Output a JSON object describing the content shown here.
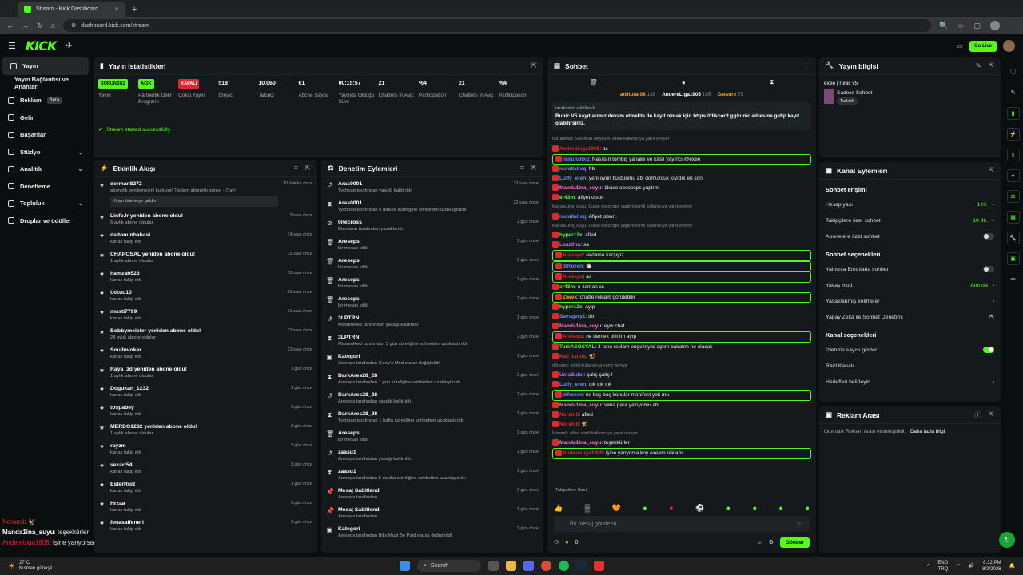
{
  "browser": {
    "tab_title": "Stream - Kick Dashboard",
    "url": "dashboard.kick.com/stream"
  },
  "nav": {
    "logo": "KICK",
    "golive": "Go Live"
  },
  "sidebar": {
    "items": [
      {
        "label": "Yayın"
      },
      {
        "label": "Yayın Bağlantısı ve Anahtarı"
      },
      {
        "label": "Reklam",
        "badge": "Beta"
      },
      {
        "label": "Gelir"
      },
      {
        "label": "Başarılar"
      },
      {
        "label": "Stüdyo"
      },
      {
        "label": "Analitik"
      },
      {
        "label": "Denetleme"
      },
      {
        "label": "Topluluk"
      },
      {
        "label": "Droplar ve ödüller"
      }
    ]
  },
  "overlay": [
    {
      "u": "Noramli",
      "m": ": 🦅"
    },
    {
      "u": "Manda1ina_suyu",
      "m": ": teşekkürler"
    },
    {
      "u": "AndereLiga1905",
      "m": ": işine yanyorsa koy exeem reklamı"
    }
  ],
  "stats": {
    "title": "Yayın İstatistikleri",
    "started": "Stream started successfully.",
    "items": [
      {
        "v": "SORUNSUZ",
        "l": "Yayın",
        "k": "g"
      },
      {
        "v": "AÇIK",
        "l": "Partnerlik Gelir Programı",
        "k": "g"
      },
      {
        "v": "KAPALI",
        "l": "Çoklu Yayın",
        "k": "r"
      },
      {
        "v": "518",
        "l": "İzleyici"
      },
      {
        "v": "10.060",
        "l": "Takipçi"
      },
      {
        "v": "61",
        "l": "Abone Sayısı"
      },
      {
        "v": "00:15:57",
        "l": "Yayında Olduğu Süre"
      },
      {
        "v": "21",
        "l": "Chatters In Avg."
      },
      {
        "v": "%4",
        "l": "Participation"
      },
      {
        "v": "21",
        "l": "Chatters In Avg."
      },
      {
        "v": "%4",
        "l": "Participation"
      }
    ]
  },
  "activity": {
    "title": "Etkinlik Akışı",
    "items": [
      {
        "i": "★",
        "t1": "derman8272",
        "t2": "abonelik yenilemesini kutluyor! Toplam abonelik süresi - 7 ay!",
        "tm": "10 dakika önce",
        "x": "Kirayı ödemeye geldim"
      },
      {
        "i": "★",
        "t1": "LinfoJr yeniden abone oldu!",
        "t2": "6 aylık abone oldular",
        "tm": "3 saat önce"
      },
      {
        "i": "♥",
        "t1": "daltonunbabasi",
        "t2": "kanalı takip etti",
        "tm": "14 saat önce"
      },
      {
        "i": "★",
        "t1": "CHAPOSAL yeniden abone oldu!",
        "t2": "1 aylık abone oldular",
        "tm": "15 saat önce"
      },
      {
        "i": "♥",
        "t1": "hamzab523",
        "t2": "kanalı takip etti",
        "tm": "18 saat önce"
      },
      {
        "i": "♥",
        "t1": "Utkuu10",
        "t2": "kanalı takip etti",
        "tm": "20 saat önce"
      },
      {
        "i": "♥",
        "t1": "musti7799",
        "t2": "kanalı takip etti",
        "tm": "21 saat önce"
      },
      {
        "i": "★",
        "t1": "Bobbymeister yeniden abone oldu!",
        "t2": "24 aylık abone oldular",
        "tm": "22 saat önce"
      },
      {
        "i": "♥",
        "t1": "Soullnvoker",
        "t2": "kanalı takip etti",
        "tm": "23 saat önce"
      },
      {
        "i": "★",
        "t1": "Raya_3d yeniden abone oldu!",
        "t2": "1 aylık abone oldular",
        "tm": "1 gün önce"
      },
      {
        "i": "♥",
        "t1": "Dogukan_1232",
        "t2": "kanalı takip etti",
        "tm": "1 gün önce"
      },
      {
        "i": "♥",
        "t1": "tospabey",
        "t2": "kanalı takip etti",
        "tm": "1 gün önce"
      },
      {
        "i": "★",
        "t1": "MERDO1282 yeniden abone oldu!",
        "t2": "1 aylık abone oldular",
        "tm": "1 gün önce"
      },
      {
        "i": "♥",
        "t1": "rayzm",
        "t2": "kanalı takip etti",
        "tm": "1 gün önce"
      },
      {
        "i": "♥",
        "t1": "sezarr54",
        "t2": "kanalı takip etti",
        "tm": "1 gün önce"
      },
      {
        "i": "♥",
        "t1": "EsterRuiz",
        "t2": "kanalı takip etti",
        "tm": "1 gün önce"
      },
      {
        "i": "♥",
        "t1": "Hrzaa",
        "t2": "kanalı takip etti",
        "tm": "1 gün önce"
      },
      {
        "i": "♥",
        "t1": "fenasalfeneri",
        "t2": "kanalı takip etti",
        "tm": "1 gün önce"
      }
    ]
  },
  "mod": {
    "title": "Denetim Eylemleri",
    "items": [
      {
        "i": "↺",
        "t1": "Aras0001",
        "t2": "Tychooo tarafından yasağı kaldırıldı",
        "tm": "22 saat önce"
      },
      {
        "i": "⧗",
        "t1": "Aras0001",
        "t2": "Tychooo tarafından 5 dakika süreliğine sohbetten uzaklaştırıldı",
        "tm": "22 saat önce"
      },
      {
        "i": "⊘",
        "t1": "0necross",
        "t2": "Ebonivon tarafından yasaklandı",
        "tm": "1 gün önce"
      },
      {
        "i": "🗑",
        "t1": "Areseps",
        "t2": "bir mesajı sildi",
        "tm": "1 gün önce"
      },
      {
        "i": "🗑",
        "t1": "Areseps",
        "t2": "bir mesajı sildi",
        "tm": "1 gün önce"
      },
      {
        "i": "🗑",
        "t1": "Areseps",
        "t2": "bir mesajı sildi",
        "tm": "1 gün önce"
      },
      {
        "i": "🗑",
        "t1": "Areseps",
        "t2": "bir mesajı sildi",
        "tm": "1 gün önce"
      },
      {
        "i": "↺",
        "t1": "3LPTRN",
        "t2": "MasumKeci tarafından yasağı kaldırıldı",
        "tm": "1 gün önce"
      },
      {
        "i": "⧗",
        "t1": "3LPTRN",
        "t2": "MasumKeci tarafından 5 gün süreliğine sohbetten uzaklaştırıldı",
        "tm": "1 gün önce"
      },
      {
        "i": "▣",
        "t1": "Kategori",
        "t2": "Areseps tarafından Garry's Mod olarak değiştirildi",
        "tm": "1 gün önce"
      },
      {
        "i": "⧗",
        "t1": "DarkAres28_28",
        "t2": "Areseps tarafından 1 gün süreliğine sohbetten uzaklaştırıldı",
        "tm": "1 gün önce"
      },
      {
        "i": "↺",
        "t1": "DarkAres28_28",
        "t2": "Areseps tarafından yasağı kaldırıldı",
        "tm": "1 gün önce"
      },
      {
        "i": "⧗",
        "t1": "DarkAres28_28",
        "t2": "Tychooo tarafından 1 hafta süreliğine sohbetten uzaklaştırıldı",
        "tm": "1 gün önce"
      },
      {
        "i": "🗑",
        "t1": "Areseps",
        "t2": "bir mesajı sildi",
        "tm": "1 gün önce"
      },
      {
        "i": "↺",
        "t1": "zaasu1",
        "t2": "Areseps tarafından yasağı kaldırıldı",
        "tm": "1 gün önce"
      },
      {
        "i": "⧗",
        "t1": "zaasu1",
        "t2": "Areseps tarafından 5 dakika süreliğine sohbetten uzaklaştırıldı",
        "tm": "1 gün önce"
      },
      {
        "i": "📌",
        "t1": "Mesaj Sabitlendi",
        "t2": "Areseps tarafından",
        "tm": "1 gün önce"
      },
      {
        "i": "📌",
        "t1": "Mesaj Sabitlendi",
        "t2": "Areseps tarafından",
        "tm": "1 gün önce"
      },
      {
        "i": "▣",
        "t1": "Kategori",
        "t2": "Areseps tarafından Bills Must Be Paid olarak değiştirildi",
        "tm": "1 gün önce"
      }
    ]
  },
  "chat": {
    "title": "Sohbet",
    "top": [
      {
        "n": "aniltutar96",
        "v": "138",
        "c": "#f5a623"
      },
      {
        "n": "AndereLiga1905",
        "v": "105",
        "c": "#fff"
      },
      {
        "n": "Gatsure",
        "v": "75",
        "c": "#f5a623"
      }
    ],
    "pinned_by": "tarafından sabitlendi",
    "pinned": "Runic V5 kayıtlarımız devam etmekte de kayıt olmak için https://discord.gg/runic adresine gidip kayıt olabilirsiniz.",
    "messages": [
      {
        "s": "nurullahxq: Selamün aleyküm. isimli kullanıcıya yanıt veriyor"
      },
      {
        "u": "AndereLiga1905",
        "c": "#e5262d",
        "m": ": as"
      },
      {
        "u": "nurullahxq",
        "c": "#6a8cff",
        "m": ": Nasılsın tombiş yanaklı ve kaslı yayıncı @exee",
        "hl": true
      },
      {
        "u": "nurullahxq",
        "c": "#6a8cff",
        "m": ": hb"
      },
      {
        "u": "Luffy_eren",
        "c": "#6a8cff",
        "m": ": yeni oyun buldunmu abi domuzcuk kıyıdık en son"
      },
      {
        "u": "Manda1ina_suyu",
        "c": "#ff7ad9",
        "m": ": 1kase cococops yaptım"
      },
      {
        "u": "er43m",
        "c": "#53fc18",
        "m": ": afiyet olsun"
      },
      {
        "s": "Manda1ina_suyu: 1kase cococops yaptım isimli kullanıcıya yanıt veriyor"
      },
      {
        "u": "nurullahxq",
        "c": "#6a8cff",
        "m": ": Afiyet olsun."
      },
      {
        "s": "Manda1ina_suyu: 1kase cococops yaptım isimli kullanıcıya yanıt veriyor"
      },
      {
        "u": "hyper12x",
        "c": "#53fc18",
        "m": ": afied"
      },
      {
        "u": "Lauz3nn",
        "c": "#a970ff",
        "m": ": sa"
      },
      {
        "u": "Areseps",
        "c": "#e5262d",
        "m": ": reklama karşıyız",
        "hl": true
      },
      {
        "u": "difrozen",
        "c": "#6a8cff",
        "m": ": 🐔",
        "hl": true
      },
      {
        "u": "Areseps",
        "c": "#e5262d",
        "m": ": as",
        "hl": true
      },
      {
        "u": "er43m",
        "c": "#53fc18",
        "m": ": o zaman cs"
      },
      {
        "u": "Ziwex",
        "c": "#f5a623",
        "m": ": chatte reklam görülebilir",
        "hl": true
      },
      {
        "u": "hyper12x",
        "c": "#53fc18",
        "m": ": ayıp"
      },
      {
        "u": "Savagery1",
        "c": "#6a8cff",
        "m": ": tün"
      },
      {
        "u": "Manda1ina_suyu",
        "c": "#ff7ad9",
        "m": ": eyw chat"
      },
      {
        "u": "Areseps",
        "c": "#e5262d",
        "m": ": ne demek biliriim ayıp",
        "hl": true
      },
      {
        "u": "TurkASOSYAL",
        "c": "#53fc18",
        "m": ": 3 tane reklam engelleyici açtım bakalım ne olacak"
      },
      {
        "u": "Kali_Lunis",
        "c": "#e5262d",
        "m": ": 🐒"
      },
      {
        "s": "difrozen: isimli kullanıcıya yanıt veriyor"
      },
      {
        "u": "UstaBulut",
        "c": "#a970ff",
        "m": ": çalış çalış !"
      },
      {
        "u": "Luffy_eren",
        "c": "#6a8cff",
        "m": ": cık cık cık"
      },
      {
        "u": "difrozen",
        "c": "#6a8cff",
        "m": ": ne boş boş konular manifest yok mu",
        "hl": true
      },
      {
        "u": "Manda1ina_suyu",
        "c": "#ff7ad9",
        "m": ": sana para yazıyomu abi"
      },
      {
        "u": "Noramli",
        "c": "#e5262d",
        "m": ": afied"
      },
      {
        "u": "Noramli",
        "c": "#e5262d",
        "m": ": 🐒"
      },
      {
        "s": "Noramli: afied isimli kullanıcıya yanıt veriyor"
      },
      {
        "u": "Manda1ina_suyu",
        "c": "#ff7ad9",
        "m": ": teşekkürler"
      },
      {
        "u": "AndereLiga1905",
        "c": "#e5262d",
        "m": ": işine yanyorsa koy exeem reklamı",
        "hl": true
      }
    ],
    "followers_only": "Takipçilere Özel",
    "placeholder": "Bir mesaj gönderin",
    "points": "0",
    "send": "Gönder"
  },
  "info": {
    "title": "Yayın bilgisi",
    "stream_title": "exee | runic v5",
    "category": "Sadece Sohbet",
    "lang": "Turkish"
  },
  "channel": {
    "title": "Kanal Eylemleri",
    "s1": "Sohbet erişimi",
    "s2": "Sohbet seçenekleri",
    "s3": "Kanal seçenekleri",
    "acc_age": "Hesap yaşı",
    "acc_age_v": "1 hf.",
    "follow_only": "Takipçilere özel sohbet",
    "follow_only_v": "10 dk.",
    "sub_only": "Abonelere özel sohbet",
    "emote_only": "Yalnızca Emotlarla sohbet",
    "slow": "Yavaş mod",
    "slow_v": "Anında",
    "banned_words": "Yasaklanmış kelimeler",
    "ai": "Yapay Zeka ile Sohbet Denetimi",
    "viewers": "İzlenme sayısı göster",
    "raid": "Raid Kanalı",
    "targets": "Hedefleri belirleyin"
  },
  "ads": {
    "title": "Reklam Arası",
    "text": "Otomatik Reklam Arası etkinleştirildi.",
    "link": "Daha fazla bilgi"
  },
  "taskbar": {
    "temp": "27°C",
    "weather": "Kısmen güneşli",
    "search": "Search",
    "lang": "ENG",
    "lang2": "TRQ",
    "time": "8:32 PM",
    "date": "8/2/2026"
  }
}
